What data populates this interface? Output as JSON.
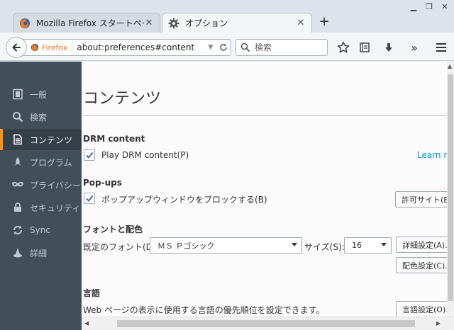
{
  "window": {
    "minimize_glyph": "▁",
    "restore_glyph": "❐",
    "close_glyph": "✕"
  },
  "tabs": [
    {
      "label": "Mozilla Firefox スタートページ",
      "icon": "firefox-icon",
      "active": false
    },
    {
      "label": "オプション",
      "icon": "gear-icon",
      "active": true
    }
  ],
  "tab_close_glyph": "✕",
  "new_tab_glyph": "+",
  "navbar": {
    "identity_label": "Firefox",
    "url": "about:preferences#content",
    "search_placeholder": "検索",
    "more_tools_glyph": "»"
  },
  "sidebar": {
    "items": [
      {
        "label": "一般",
        "icon": "general-icon",
        "selected": false
      },
      {
        "label": "検索",
        "icon": "search-icon",
        "selected": false
      },
      {
        "label": "コンテンツ",
        "icon": "content-icon",
        "selected": true
      },
      {
        "label": "プログラム",
        "icon": "applications-icon",
        "selected": false
      },
      {
        "label": "プライバシー",
        "icon": "privacy-mask-icon",
        "selected": false
      },
      {
        "label": "セキュリティ",
        "icon": "security-lock-icon",
        "selected": false
      },
      {
        "label": "Sync",
        "icon": "sync-icon",
        "selected": false
      },
      {
        "label": "詳細",
        "icon": "advanced-wizard-icon",
        "selected": false
      }
    ]
  },
  "content": {
    "title": "コンテンツ",
    "drm": {
      "heading": "DRM content",
      "checkbox_label": "Play DRM content(P)",
      "checked": true,
      "learn_more": "Learn more"
    },
    "popups": {
      "heading": "Pop-ups",
      "checkbox_label": "ポップアップウィンドウをブロックする(B)",
      "checked": true,
      "exceptions_button": "許可サイト(E)..."
    },
    "fonts": {
      "heading": "フォントと配色",
      "default_font_label": "既定のフォント(D):",
      "default_font_value": "ＭＳ Ｐゴシック",
      "size_label": "サイズ(S):",
      "size_value": "16",
      "advanced_button": "詳細設定(A)...",
      "colors_button": "配色設定(C)..."
    },
    "languages": {
      "heading": "言語",
      "description": "Web ページの表示に使用する言語の優先順位を設定できます。",
      "choose_button": "言語設定(O)..."
    }
  },
  "colors": {
    "accent": "#ff9500",
    "link": "#0096dd",
    "sidebar_bg": "#424f5a",
    "checkmark": "#3c6fb0"
  }
}
